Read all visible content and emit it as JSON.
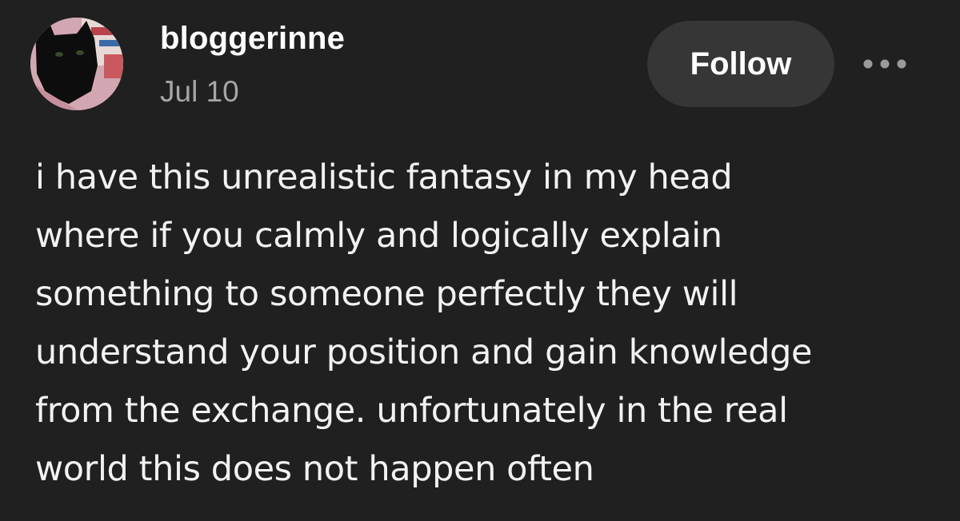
{
  "post": {
    "author": {
      "username": "bloggerinne",
      "avatar_icon": "cat-avatar"
    },
    "date": "Jul 10",
    "follow_label": "Follow",
    "more_icon": "more-horizontal-icon",
    "body_lines": [
      "i have this unrealistic fantasy in my head",
      "where if you calmly and logically explain",
      "something to someone perfectly they will",
      "understand your position and gain knowledge",
      "from the exchange. unfortunately in the real",
      "world this does not happen often"
    ]
  },
  "colors": {
    "background": "#202020",
    "button_bg": "#363636",
    "text": "#ffffff",
    "muted_text": "#a6a6a6"
  }
}
